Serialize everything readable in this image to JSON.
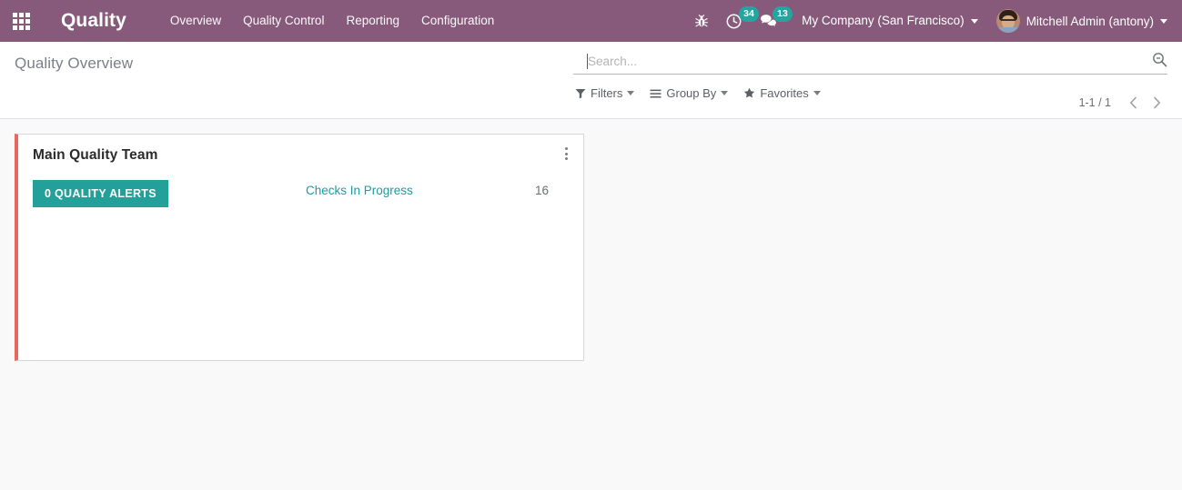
{
  "navbar": {
    "apps_icon": "apps-grid-icon",
    "brand": "Quality",
    "menu_items": [
      {
        "label": "Overview"
      },
      {
        "label": "Quality Control"
      },
      {
        "label": "Reporting"
      },
      {
        "label": "Configuration"
      }
    ],
    "debug_icon": "bug-icon",
    "activities": {
      "icon": "clock-icon",
      "count": "34"
    },
    "messages": {
      "icon": "chat-bubble-icon",
      "count": "13"
    },
    "company": "My Company (San Francisco)",
    "user": "Mitchell Admin (antony)",
    "avatar_icon": "user-avatar"
  },
  "control_panel": {
    "page_title": "Quality Overview",
    "search": {
      "placeholder": "Search...",
      "value": "",
      "icon": "search-icon"
    },
    "tools": [
      {
        "label": "Filters",
        "icon": "filter-funnel-icon"
      },
      {
        "label": "Group By",
        "icon": "list-lines-icon"
      },
      {
        "label": "Favorites",
        "icon": "star-icon"
      }
    ],
    "pager": {
      "value": "1-1 / 1",
      "prev_icon": "chevron-left-icon",
      "next_icon": "chevron-right-icon"
    }
  },
  "kanban": {
    "cards": [
      {
        "title": "Main Quality Team",
        "accent_color": "#e8685c",
        "menu_icon": "vertical-dots-icon",
        "alerts_button": {
          "label": "0 QUALITY ALERTS",
          "color": "#23a09a"
        },
        "stats": [
          {
            "label": "Checks In Progress",
            "value": "16"
          }
        ]
      }
    ]
  },
  "colors": {
    "navbar": "#875a7b",
    "accent_teal": "#23a09a",
    "link_teal": "#1d9ba3",
    "card_accent": "#e8685c",
    "background": "#f9f9f9"
  }
}
